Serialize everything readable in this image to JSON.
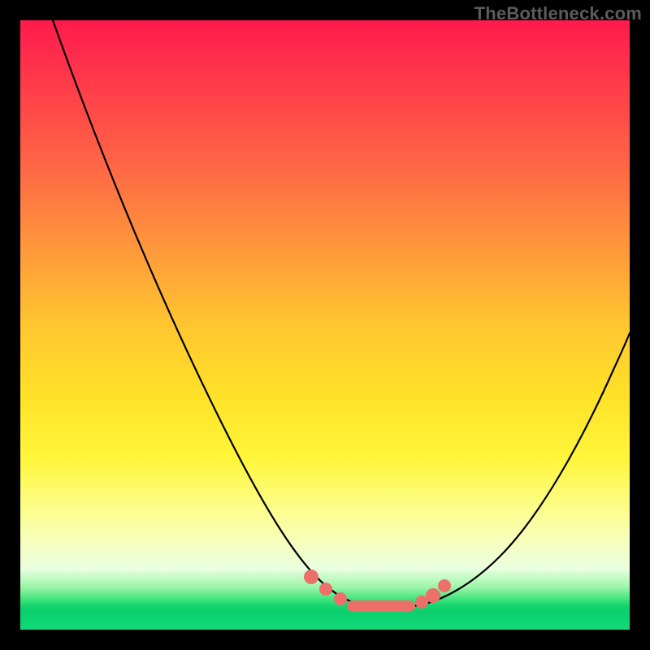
{
  "watermark": "TheBottleneck.com",
  "chart_data": {
    "type": "line",
    "title": "",
    "xlabel": "",
    "ylabel": "",
    "xlim": [
      0,
      100
    ],
    "ylim": [
      0,
      100
    ],
    "series": [
      {
        "name": "bottleneck-curve",
        "x": [
          5,
          10,
          15,
          20,
          25,
          30,
          35,
          40,
          45,
          48,
          50,
          52,
          55,
          58,
          60,
          63,
          67,
          72,
          78,
          85,
          92,
          100
        ],
        "y": [
          100,
          90,
          80,
          70,
          58,
          46,
          34,
          23,
          13,
          8,
          6,
          5,
          4,
          4,
          4,
          5,
          7,
          12,
          20,
          32,
          46,
          60
        ]
      }
    ],
    "markers": {
      "name": "highlight-dots",
      "color": "#ec6f6a",
      "x": [
        47,
        49,
        52,
        55,
        58,
        61,
        63,
        65
      ],
      "y": [
        9,
        6,
        5,
        4,
        4,
        4.5,
        6,
        8
      ]
    },
    "gradient_stops": [
      {
        "pos": 0.0,
        "color": "#ff1a4d"
      },
      {
        "pos": 0.5,
        "color": "#ffc62f"
      },
      {
        "pos": 0.8,
        "color": "#fcfd8a"
      },
      {
        "pos": 0.95,
        "color": "#40e47e"
      },
      {
        "pos": 1.0,
        "color": "#12d878"
      }
    ]
  }
}
